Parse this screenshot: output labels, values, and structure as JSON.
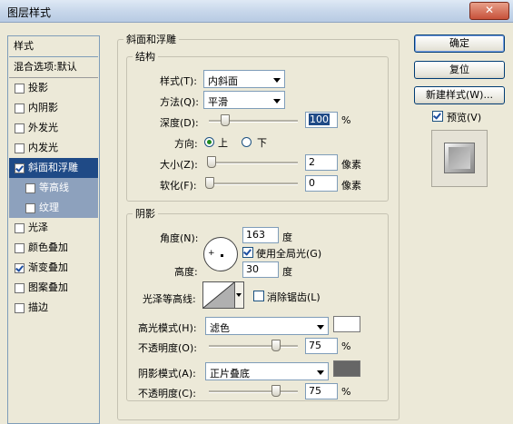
{
  "window": {
    "title": "图层样式",
    "close_glyph": "✕"
  },
  "style_list": {
    "header": "样式",
    "blend_options": "混合选项:默认",
    "items": [
      {
        "label": "投影",
        "checked": false
      },
      {
        "label": "内阴影",
        "checked": false
      },
      {
        "label": "外发光",
        "checked": false
      },
      {
        "label": "内发光",
        "checked": false
      },
      {
        "label": "斜面和浮雕",
        "checked": true,
        "selected": true
      },
      {
        "label": "等高线",
        "checked": false,
        "sub": true
      },
      {
        "label": "纹理",
        "checked": false,
        "sub": true
      },
      {
        "label": "光泽",
        "checked": false
      },
      {
        "label": "颜色叠加",
        "checked": false
      },
      {
        "label": "渐变叠加",
        "checked": true
      },
      {
        "label": "图案叠加",
        "checked": false
      },
      {
        "label": "描边",
        "checked": false
      }
    ]
  },
  "bevel": {
    "title": "斜面和浮雕",
    "structure": {
      "title": "结构",
      "style_label": "样式(T):",
      "style_value": "内斜面",
      "technique_label": "方法(Q):",
      "technique_value": "平滑",
      "depth_label": "深度(D):",
      "depth_value": "100",
      "depth_pct": 100,
      "unit_percent": "%",
      "direction_label": "方向:",
      "dir_up": "上",
      "dir_down": "下",
      "size_label": "大小(Z):",
      "size_value": "2",
      "size_unit": "像素",
      "soften_label": "软化(F):",
      "soften_value": "0",
      "soften_unit": "像素"
    },
    "shading": {
      "title": "阴影",
      "angle_label": "角度(N):",
      "angle_value": "163",
      "angle_unit": "度",
      "global_light": "使用全局光(G)",
      "altitude_label": "高度:",
      "altitude_value": "30",
      "altitude_unit": "度",
      "gloss_label": "光泽等高线:",
      "antialias": "消除锯齿(L)",
      "highlight_mode_label": "高光模式(H):",
      "highlight_mode_value": "滤色",
      "highlight_color": "#ffffff",
      "highlight_opacity_label": "不透明度(O):",
      "highlight_opacity_value": "75",
      "shadow_mode_label": "阴影模式(A):",
      "shadow_mode_value": "正片叠底",
      "shadow_color": "#666666",
      "shadow_opacity_label": "不透明度(C):",
      "shadow_opacity_value": "75",
      "unit_percent": "%"
    }
  },
  "buttons": {
    "ok": "确定",
    "reset": "复位",
    "new_style": "新建样式(W)...",
    "preview": "预览(V)"
  }
}
